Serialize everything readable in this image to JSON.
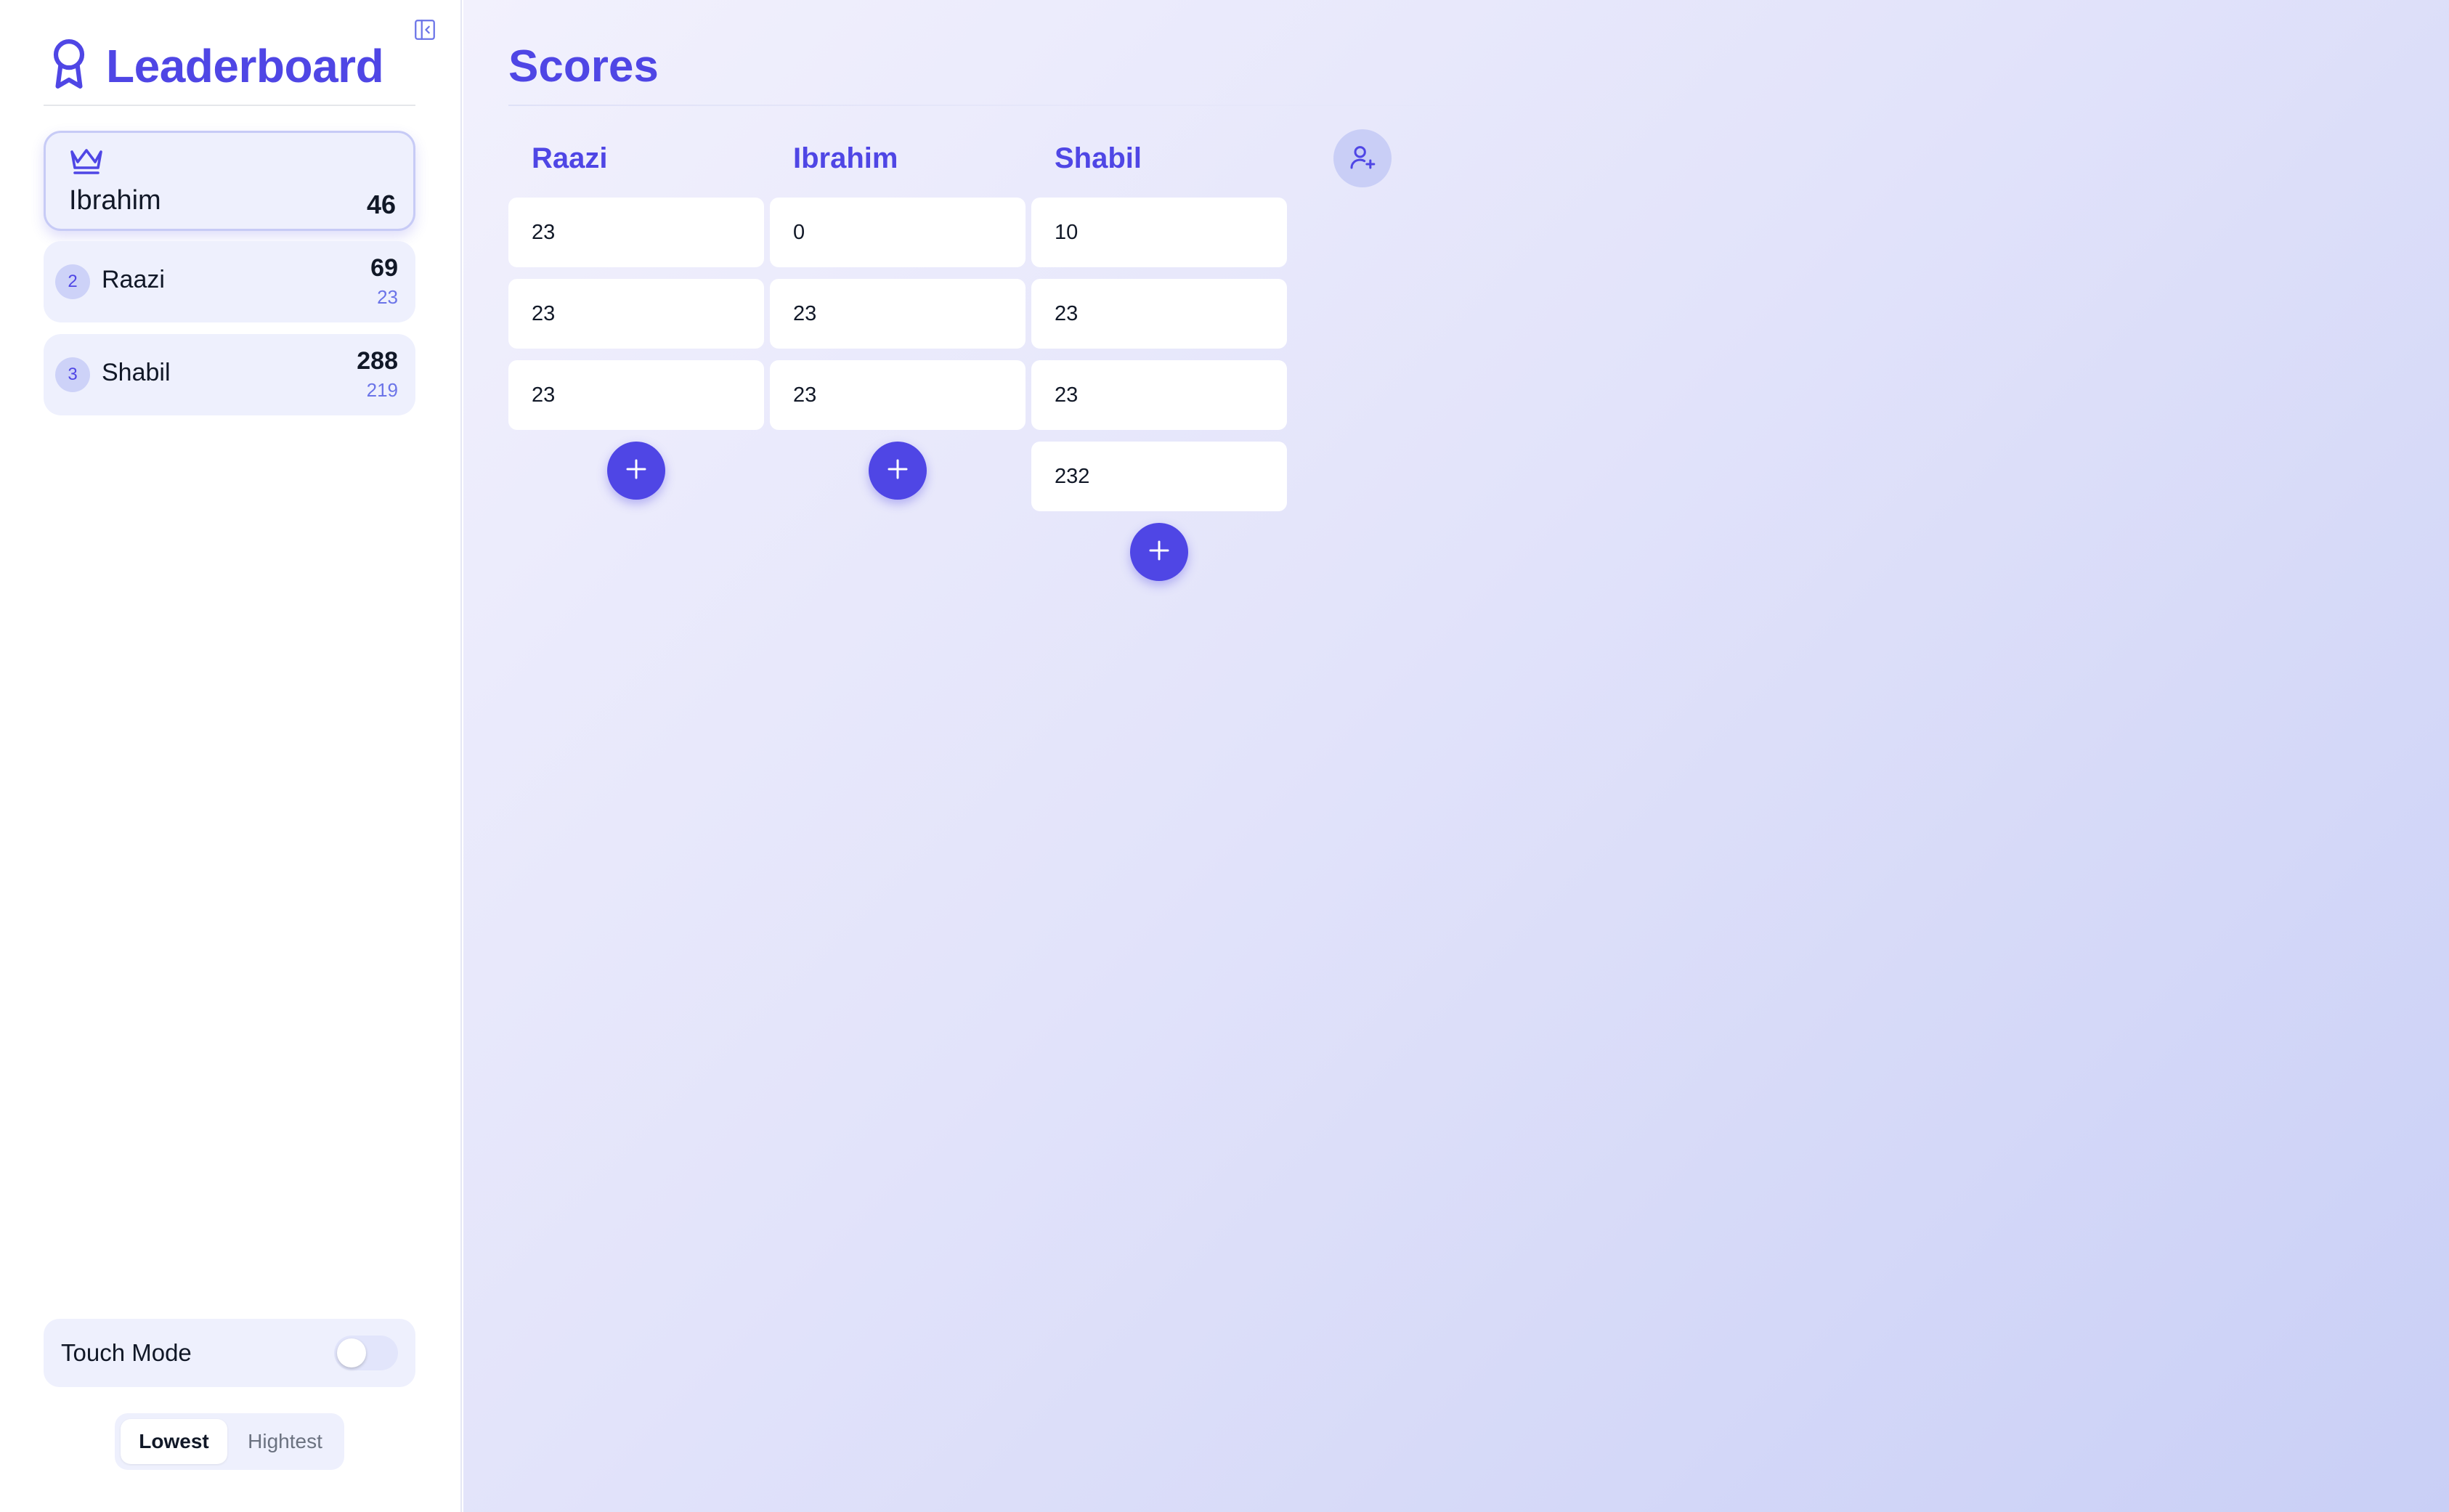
{
  "sidebar": {
    "title": "Leaderboard",
    "leader": {
      "name": "Ibrahim",
      "score": "46"
    },
    "rows": [
      {
        "rank": "2",
        "name": "Raazi",
        "score": "69",
        "diff": "23"
      },
      {
        "rank": "3",
        "name": "Shabil",
        "score": "288",
        "diff": "219"
      }
    ],
    "touch_mode": {
      "label": "Touch Mode",
      "enabled": false
    },
    "sort": {
      "options": [
        "Lowest",
        "Hightest"
      ],
      "selected": "Lowest"
    }
  },
  "main": {
    "title": "Scores",
    "players": [
      {
        "name": "Raazi",
        "scores": [
          "23",
          "23",
          "23"
        ]
      },
      {
        "name": "Ibrahim",
        "scores": [
          "0",
          "23",
          "23"
        ]
      },
      {
        "name": "Shabil",
        "scores": [
          "10",
          "23",
          "23",
          "232"
        ]
      }
    ]
  },
  "icons": {
    "collapse": "sidebar-collapse-icon",
    "brand": "award-ribbon-icon",
    "crown": "crown-icon",
    "add_score": "plus-icon",
    "add_player": "user-plus-icon"
  },
  "colors": {
    "accent": "#4f46e5",
    "badge_bg": "#cdd2f8",
    "card_bg": "#eef0fd"
  }
}
